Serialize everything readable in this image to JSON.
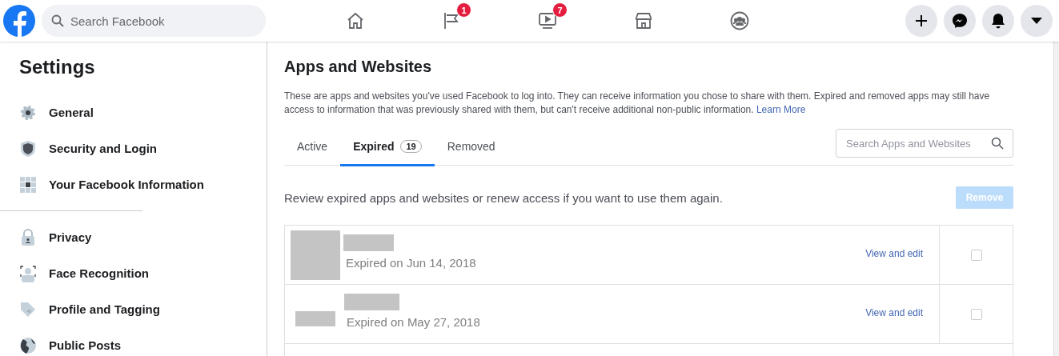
{
  "topbar": {
    "search": {
      "placeholder": "Search Facebook"
    },
    "nav": [
      {
        "kind": "home"
      },
      {
        "kind": "flag",
        "badge": "1"
      },
      {
        "kind": "video",
        "badge": "7"
      },
      {
        "kind": "store"
      },
      {
        "kind": "groups"
      }
    ],
    "actions": [
      {
        "kind": "plus"
      },
      {
        "kind": "messenger"
      },
      {
        "kind": "bell"
      },
      {
        "kind": "caret"
      }
    ]
  },
  "sidebar": {
    "title": "Settings",
    "groups": [
      [
        {
          "kind": "gear",
          "label": "General"
        },
        {
          "kind": "shield",
          "label": "Security and Login"
        },
        {
          "kind": "grid",
          "label": "Your Facebook Information"
        }
      ],
      [
        {
          "kind": "lock",
          "label": "Privacy"
        },
        {
          "kind": "face",
          "label": "Face Recognition"
        },
        {
          "kind": "tag",
          "label": "Profile and Tagging"
        },
        {
          "kind": "globe",
          "label": "Public Posts"
        }
      ]
    ]
  },
  "main": {
    "title": "Apps and Websites",
    "intro": "These are apps and websites you've used Facebook to log into. They can receive information you chose to share with them. Expired and removed apps may still have access to information that was previously shared with them, but can't receive additional non-public information.",
    "learn_more": "Learn More",
    "tabs": [
      {
        "label": "Active",
        "selected": false
      },
      {
        "label": "Expired",
        "count": "19",
        "selected": true
      },
      {
        "label": "Removed",
        "selected": false
      }
    ],
    "search": {
      "placeholder": "Search Apps and Websites"
    },
    "review": "Review expired apps and websites or renew access if you want to use them again.",
    "remove_button": {
      "label": "Remove",
      "disabled": true
    },
    "rows": [
      {
        "kind": "square",
        "expired": "Expired on Jun 14, 2018",
        "link": "View and edit",
        "checked": false
      },
      {
        "kind": "wide",
        "expired": "Expired on May 27, 2018",
        "link": "View and edit",
        "checked": false
      }
    ]
  }
}
